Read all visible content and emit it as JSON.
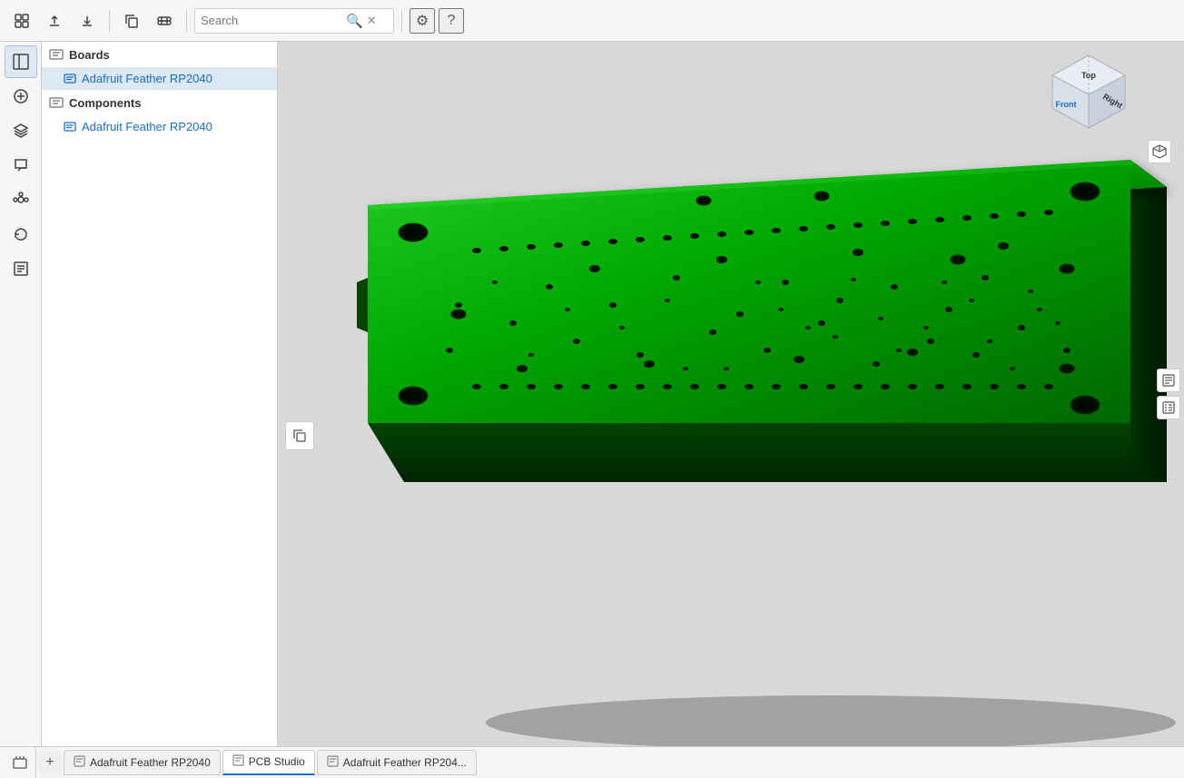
{
  "app": {
    "title": "PCB Studio"
  },
  "toolbar": {
    "search_placeholder": "Search",
    "upload_label": "Upload",
    "download_label": "Download",
    "copy_label": "Copy",
    "link_label": "Link",
    "search_icon": "🔍",
    "clear_icon": "✕",
    "settings_icon": "⚙",
    "help_icon": "?"
  },
  "sidebar": {
    "boards_label": "Boards",
    "board_item_label": "Adafruit Feather RP2040",
    "components_label": "Components",
    "component_item_label": "Adafruit Feather RP2040"
  },
  "rail": {
    "items": [
      {
        "name": "menu-icon",
        "icon": "☰",
        "active": true
      },
      {
        "name": "add-icon",
        "icon": "+",
        "active": false
      },
      {
        "name": "layers-icon",
        "icon": "◧",
        "active": false
      },
      {
        "name": "chat-icon",
        "icon": "💬",
        "active": false
      },
      {
        "name": "pin-icon",
        "icon": "📌",
        "active": false
      },
      {
        "name": "history-icon",
        "icon": "↺",
        "active": false
      },
      {
        "name": "grid-icon",
        "icon": "⊞",
        "active": false
      }
    ]
  },
  "nav_cube": {
    "top_label": "Top",
    "front_label": "Front",
    "right_label": "Right"
  },
  "tabs": [
    {
      "label": "Adafruit Feather RP2040",
      "icon": "📋",
      "active": false
    },
    {
      "label": "PCB Studio",
      "icon": "📋",
      "active": true
    },
    {
      "label": "Adafruit Feather RP204...",
      "icon": "📋",
      "active": false
    }
  ],
  "floating_button": {
    "icon": "📋"
  },
  "right_panel": {
    "list_icon_1": "≡",
    "list_icon_2": "≡"
  }
}
